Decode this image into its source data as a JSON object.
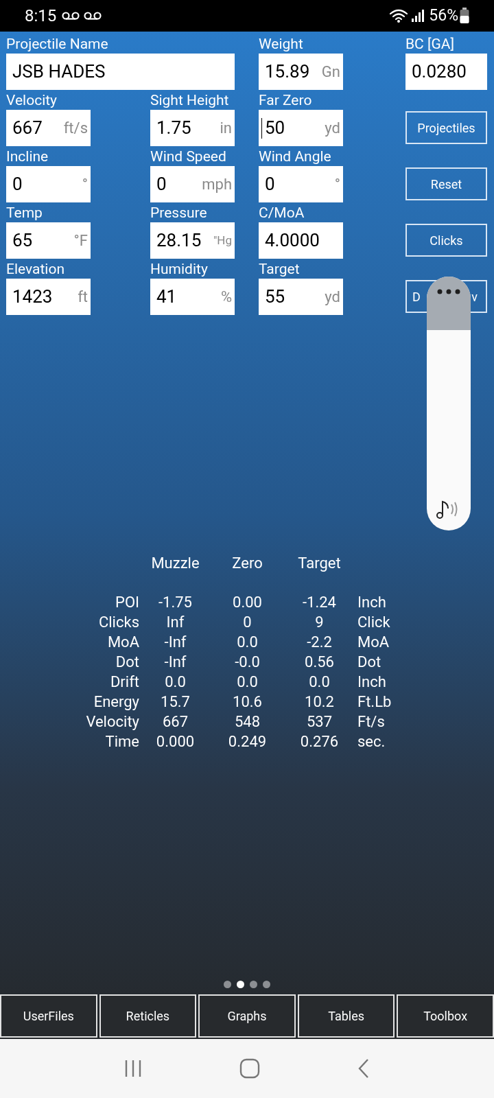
{
  "status_bar": {
    "time": "8:15",
    "battery": "56%"
  },
  "form_rows": [
    {
      "items": [
        {
          "kind": "wide_field",
          "label": "Projectile Name",
          "value": "JSB HADES",
          "focused": false
        },
        {
          "kind": "field",
          "label": "Weight",
          "value": "15.89",
          "unit": "Gn",
          "focused": false
        },
        {
          "kind": "field",
          "label": "BC [GA]",
          "value": "0.0280",
          "focused": false
        }
      ]
    },
    {
      "items": [
        {
          "kind": "field",
          "label": "Velocity",
          "value": "667",
          "unit": "ft/s",
          "focused": false
        },
        {
          "kind": "field",
          "label": "Sight Height",
          "value": "1.75",
          "unit": "in",
          "focused": false
        },
        {
          "kind": "field",
          "label": "Far Zero",
          "value": "50",
          "unit": "yd",
          "focused": true
        },
        {
          "kind": "button",
          "label": "Projectiles"
        }
      ]
    },
    {
      "items": [
        {
          "kind": "field",
          "label": "Incline",
          "value": "0",
          "unit": "°",
          "focused": false
        },
        {
          "kind": "field",
          "label": "Wind Speed",
          "value": "0",
          "unit": "mph",
          "focused": false
        },
        {
          "kind": "field",
          "label": "Wind Angle",
          "value": "0",
          "unit": "°",
          "focused": false
        },
        {
          "kind": "button",
          "label": "Reset"
        }
      ]
    },
    {
      "items": [
        {
          "kind": "field",
          "label": "Temp",
          "value": "65",
          "unit": "°F",
          "focused": false
        },
        {
          "kind": "field",
          "label": "Pressure",
          "value": "28.15",
          "unit": "\"Hg",
          "focused": false
        },
        {
          "kind": "field",
          "label": "C/MoA",
          "value": "4.0000",
          "focused": false
        },
        {
          "kind": "button",
          "label": "Clicks"
        }
      ]
    },
    {
      "items": [
        {
          "kind": "field",
          "label": "Elevation",
          "value": "1423",
          "unit": "ft",
          "focused": false
        },
        {
          "kind": "field",
          "label": "Humidity",
          "value": "41",
          "unit": "%",
          "focused": false
        },
        {
          "kind": "field",
          "label": "Target",
          "value": "55",
          "unit": "yd",
          "focused": false
        },
        {
          "kind": "covered_button",
          "label_start": "D",
          "label_end": "v"
        }
      ]
    }
  ],
  "results": {
    "columns": [
      "Muzzle",
      "Zero",
      "Target"
    ],
    "rows": [
      {
        "label": "POI",
        "values": [
          "-1.75",
          "0.00",
          "-1.24"
        ],
        "unit": "Inch"
      },
      {
        "label": "Clicks",
        "values": [
          "Inf",
          "0",
          "9"
        ],
        "unit": "Click"
      },
      {
        "label": "MoA",
        "values": [
          "-Inf",
          "0.0",
          "-2.2"
        ],
        "unit": "MoA"
      },
      {
        "label": "Dot",
        "values": [
          "-Inf",
          "-0.0",
          "0.56"
        ],
        "unit": "Dot"
      },
      {
        "label": "Drift",
        "values": [
          "0.0",
          "0.0",
          "0.0"
        ],
        "unit": "Inch"
      },
      {
        "label": "Energy",
        "values": [
          "15.7",
          "10.6",
          "10.2"
        ],
        "unit": "Ft.Lb"
      },
      {
        "label": "Velocity",
        "values": [
          "667",
          "548",
          "537"
        ],
        "unit": "Ft/s"
      },
      {
        "label": "Time",
        "values": [
          "0.000",
          "0.249",
          "0.276"
        ],
        "unit": "sec."
      }
    ]
  },
  "pages": [
    {
      "selected": false
    },
    {
      "selected": true
    },
    {
      "selected": false
    },
    {
      "selected": false
    }
  ],
  "bottom_buttons": [
    "UserFiles",
    "Reticles",
    "Graphs",
    "Tables",
    "Toolbox"
  ]
}
